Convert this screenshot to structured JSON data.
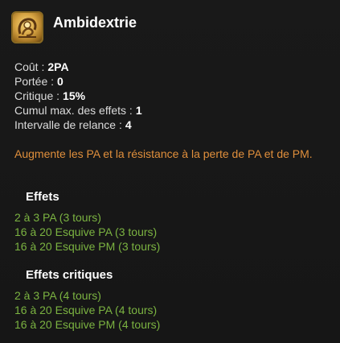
{
  "spell": {
    "name": "Ambidextrie",
    "icon": "ambidextry-spell-icon"
  },
  "stats": [
    {
      "label": "Coût :",
      "value": "2PA"
    },
    {
      "label": "Portée :",
      "value": "0"
    },
    {
      "label": "Critique :",
      "value": "15%"
    },
    {
      "label": "Cumul max. des effets :",
      "value": "1"
    },
    {
      "label": "Intervalle de relance :",
      "value": "4"
    }
  ],
  "description": "Augmente les PA et la résistance à la perte de PA et de PM.",
  "effects": {
    "title": "Effets",
    "items": [
      "2 à 3 PA (3 tours)",
      "16 à 20 Esquive PA (3 tours)",
      "16 à 20 Esquive PM (3 tours)"
    ]
  },
  "critical_effects": {
    "title": "Effets critiques",
    "items": [
      "2 à 3 PA (4 tours)",
      "16 à 20 Esquive PA (4 tours)",
      "16 à 20 Esquive PM (4 tours)"
    ]
  },
  "colors": {
    "background": "#181818",
    "description": "#e08f3c",
    "effect": "#7bb341",
    "value": "#ffffff"
  }
}
